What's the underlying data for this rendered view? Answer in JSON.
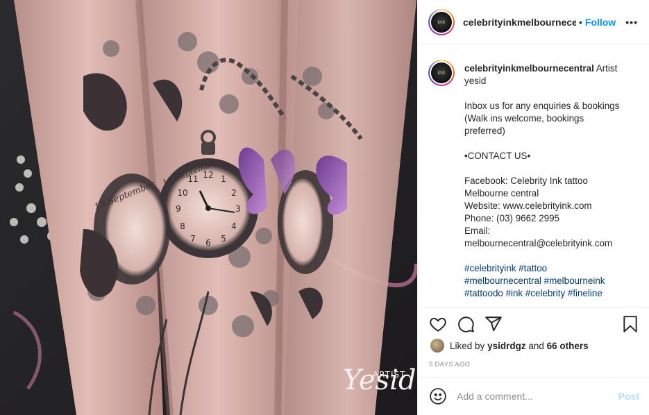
{
  "post": {
    "username": "celebrityinkmelbournecer",
    "follow_label": "Follow",
    "separator": "•",
    "more_label": "•••",
    "image_overlay": {
      "artist_label": "ARTIST",
      "signature": "Yesid"
    }
  },
  "caption": {
    "username": "celebrityinkmelbournecentral",
    "lines": [
      "Artist",
      "yesid",
      "",
      "Inbox us for any enquiries & bookings",
      "(Walk ins welcome, bookings",
      "preferred)",
      "",
      "•CONTACT US•",
      "",
      "Facebook: Celebrity Ink tattoo",
      "Melbourne central",
      "Website: www.celebrityink.com",
      "Phone: (03) 9662 2995",
      "Email:",
      "melbournecentral@celebrityink.com",
      ""
    ],
    "hashtag_lines": [
      "#celebrityink #tattoo",
      "#melbournecentral #melbourneink",
      "#tattoodo #ink #celebrity #fineline"
    ]
  },
  "actions": {
    "like_icon": "heart-icon",
    "comment_icon": "comment-icon",
    "share_icon": "paper-plane-icon",
    "save_icon": "bookmark-icon"
  },
  "likes": {
    "prefix": "Liked by",
    "user": "ysidrdgz",
    "conjunction": "and",
    "others": "66 others"
  },
  "timestamp": "5 DAYS AGO",
  "comment_box": {
    "placeholder": "Add a comment...",
    "post_label": "Post",
    "emoji_icon": "smiley-icon"
  },
  "colors": {
    "follow_blue": "#0095f6",
    "hashtag_blue": "#00376b",
    "post_disabled": "#b2dffc",
    "muted_gray": "#8e8e8e"
  }
}
